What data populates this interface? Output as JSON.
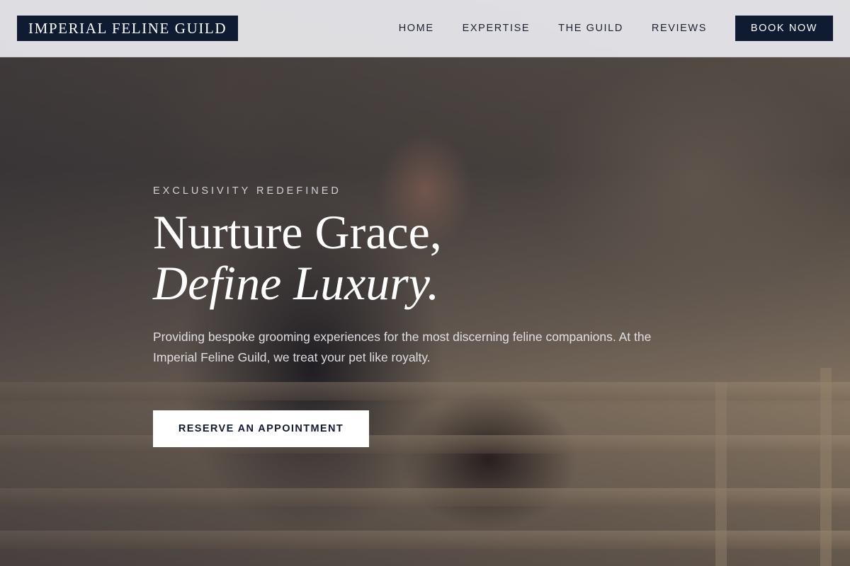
{
  "header": {
    "logo": "IMPERIAL FELINE GUILD",
    "nav": [
      {
        "label": "HOME"
      },
      {
        "label": "EXPERTISE"
      },
      {
        "label": "THE GUILD"
      },
      {
        "label": "REVIEWS"
      }
    ],
    "cta_label": "BOOK NOW"
  },
  "hero": {
    "eyebrow": "EXCLUSIVITY REDEFINED",
    "headline_line1": "Nurture Grace,",
    "headline_line2": "Define Luxury.",
    "subtext": "Providing bespoke grooming experiences for the most discerning feline companions. At the Imperial Feline Guild, we treat your pet like royalty.",
    "cta_label": "RESERVE AN APPOINTMENT"
  },
  "colors": {
    "brand_navy": "#0f1a33",
    "header_bg": "#e8e8ec",
    "white": "#ffffff"
  }
}
